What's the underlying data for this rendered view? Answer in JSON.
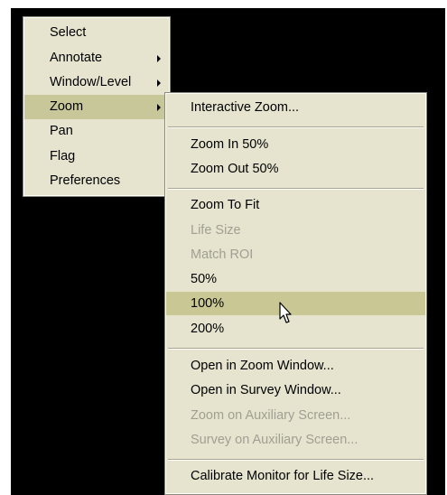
{
  "main_menu": {
    "items": [
      {
        "label": "Select"
      },
      {
        "label": "Annotate",
        "submenu": true
      },
      {
        "label": "Window/Level",
        "submenu": true
      },
      {
        "label": "Zoom",
        "submenu": true,
        "selected": true
      },
      {
        "label": "Pan"
      },
      {
        "label": "Flag"
      },
      {
        "label": "Preferences"
      }
    ]
  },
  "zoom_submenu": {
    "items": [
      {
        "label": "Interactive Zoom...",
        "enabled": true
      },
      {
        "label": "Zoom In 50%",
        "enabled": true
      },
      {
        "label": "Zoom Out 50%",
        "enabled": true
      },
      {
        "label": "Zoom To Fit",
        "enabled": true
      },
      {
        "label": "Life Size",
        "enabled": false
      },
      {
        "label": "Match ROI",
        "enabled": false
      },
      {
        "label": "50%",
        "enabled": true
      },
      {
        "label": "100%",
        "enabled": true,
        "hovered": true
      },
      {
        "label": "200%",
        "enabled": true
      },
      {
        "label": "Open in Zoom Window...",
        "enabled": true
      },
      {
        "label": "Open in Survey Window...",
        "enabled": true
      },
      {
        "label": "Zoom on Auxiliary Screen...",
        "enabled": false
      },
      {
        "label": "Survey on Auxiliary Screen...",
        "enabled": false
      },
      {
        "label": "Calibrate Monitor for Life Size...",
        "enabled": true
      }
    ]
  },
  "cursor": {
    "icon": "arrow-pointer-icon"
  }
}
